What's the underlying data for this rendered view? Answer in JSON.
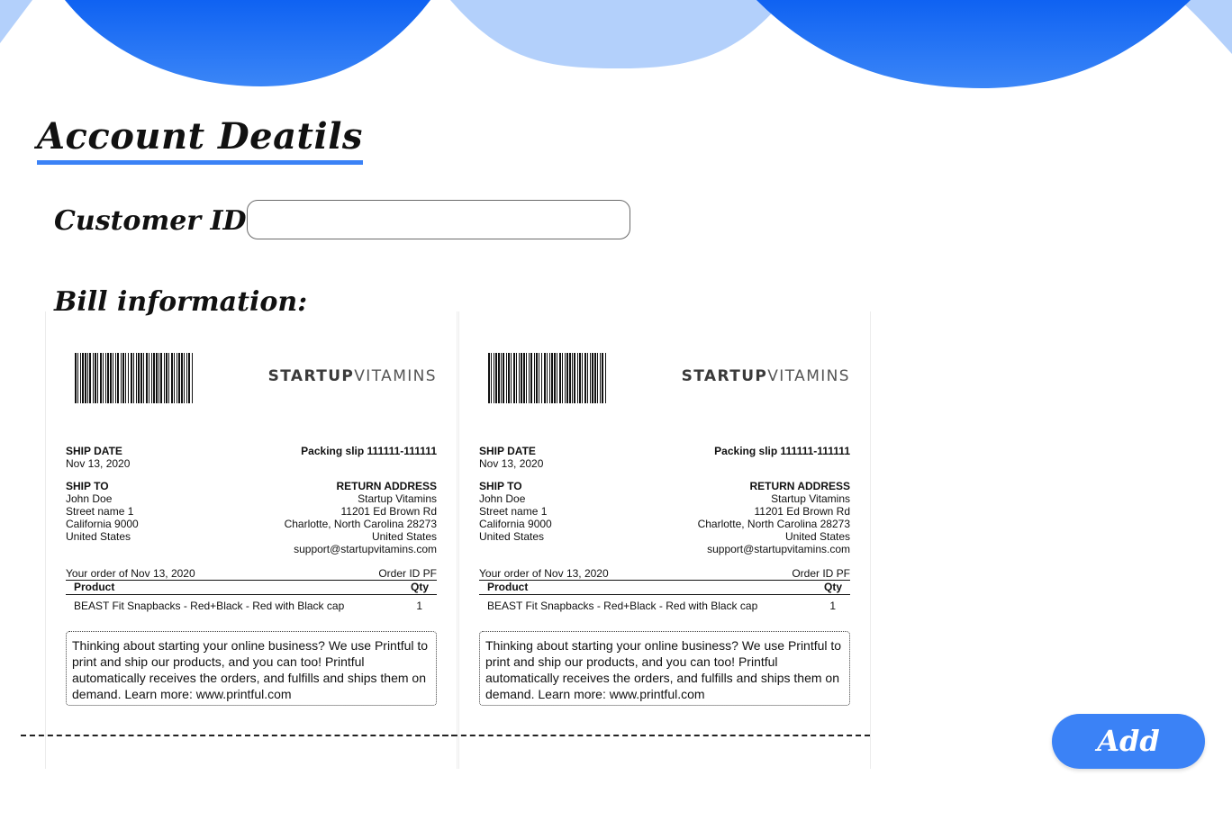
{
  "colors": {
    "accent": "#3b82f6",
    "wave_dark": "#1e6ff0",
    "wave_light": "#b3d0fb"
  },
  "page": {
    "title": "Account Deatils",
    "customer_id_label": "Customer ID:",
    "customer_id_value": "",
    "bill_info_label": "Bill information:",
    "add_button_label": "Add"
  },
  "slips": [
    {
      "brand_bold": "STARTUP",
      "brand_light": "VITAMINS",
      "ship_date_label": "SHIP DATE",
      "ship_date": "Nov 13, 2020",
      "packing_slip": "Packing slip 111111-111111",
      "ship_to_label": "SHIP TO",
      "ship_to": [
        "John Doe",
        "Street name 1",
        "California 9000",
        "United States"
      ],
      "return_label": "RETURN ADDRESS",
      "return_address": [
        "Startup Vitamins",
        "11201 Ed Brown Rd",
        "Charlotte, North Carolina 28273",
        "United States",
        "support@startupvitamins.com"
      ],
      "order_text": "Your order of Nov 13, 2020",
      "order_id": "Order ID PF",
      "product_header": "Product",
      "qty_header": "Qty",
      "product": "BEAST Fit Snapbacks - Red+Black - Red with Black cap",
      "qty": "1",
      "promo": "Thinking about starting your online business? We use Printful to print and ship our products, and you can too! Printful automatically receives the orders, and fulfills and ships them on demand. Learn more: www.printful.com"
    },
    {
      "brand_bold": "STARTUP",
      "brand_light": "VITAMINS",
      "ship_date_label": "SHIP DATE",
      "ship_date": "Nov 13, 2020",
      "packing_slip": "Packing slip 111111-111111",
      "ship_to_label": "SHIP TO",
      "ship_to": [
        "John Doe",
        "Street name 1",
        "California 9000",
        "United States"
      ],
      "return_label": "RETURN ADDRESS",
      "return_address": [
        "Startup Vitamins",
        "11201 Ed Brown Rd",
        "Charlotte, North Carolina 28273",
        "United States",
        "support@startupvitamins.com"
      ],
      "order_text": "Your order of Nov 13, 2020",
      "order_id": "Order ID PF",
      "product_header": "Product",
      "qty_header": "Qty",
      "product": "BEAST Fit Snapbacks - Red+Black - Red with Black cap",
      "qty": "1",
      "promo": "Thinking about starting your online business? We use Printful to print and ship our products, and you can too! Printful automatically receives the orders, and fulfills and ships them on demand. Learn more: www.printful.com"
    }
  ]
}
